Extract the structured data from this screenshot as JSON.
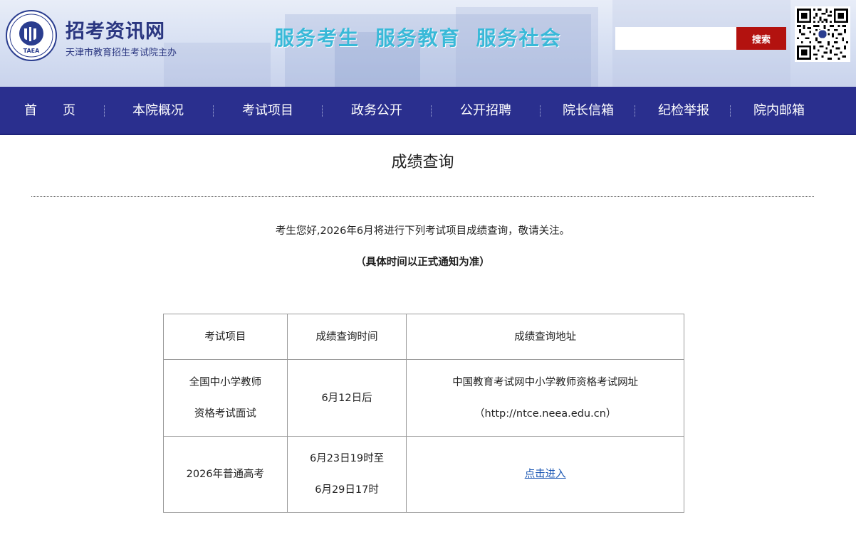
{
  "header": {
    "logo_text": "TAEA",
    "site_name": "招考资讯网",
    "site_subtitle": "天津市教育招生考试院主办",
    "slogan": "服务考生  服务教育  服务社会",
    "search": {
      "placeholder": "",
      "value": "",
      "button_label": "搜索"
    },
    "colors": {
      "slogan": "#39b9d8",
      "search_button": "#b3120f",
      "brand": "#2a3680"
    }
  },
  "nav": {
    "background": "#2a2f8e",
    "items": [
      {
        "label": "首　　页"
      },
      {
        "label": "本院概况"
      },
      {
        "label": "考试项目"
      },
      {
        "label": "政务公开"
      },
      {
        "label": "公开招聘"
      },
      {
        "label": "院长信箱"
      },
      {
        "label": "纪检举报"
      },
      {
        "label": "院内邮箱"
      }
    ]
  },
  "main": {
    "title": "成绩查询",
    "notice": "考生您好,2026年6月将进行下列考试项目成绩查询，敬请关注。",
    "notice_note": "（具体时间以正式通知为准）",
    "table": {
      "headers": [
        "考试项目",
        "成绩查询时间",
        "成绩查询地址"
      ],
      "rows": [
        {
          "project": [
            "全国中小学教师",
            "资格考试面试"
          ],
          "time": [
            "6月12日后"
          ],
          "address": [
            "中国教育考试网中小学教师资格考试网址",
            "（http://ntce.neea.edu.cn）"
          ]
        },
        {
          "project": [
            "2026年普通高考"
          ],
          "time": [
            "6月23日19时至",
            "6月29日17时"
          ],
          "address_link": "点击进入"
        }
      ]
    }
  }
}
